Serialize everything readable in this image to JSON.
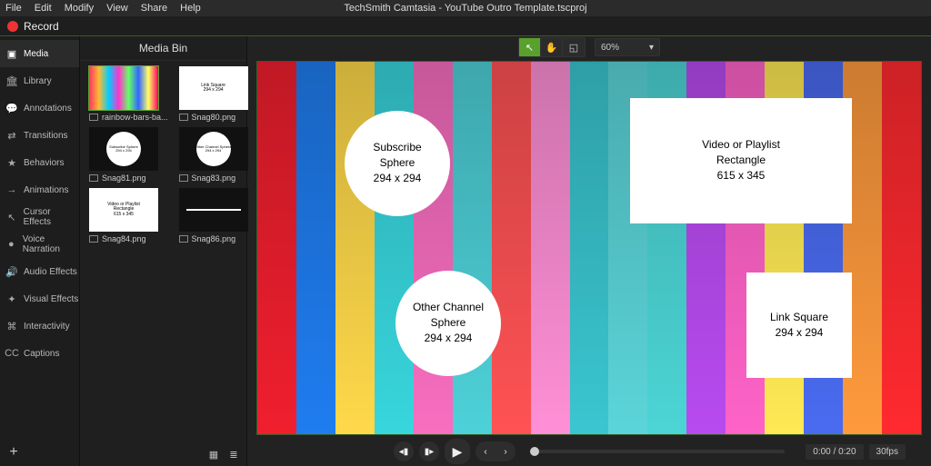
{
  "app_title": "TechSmith Camtasia - YouTube Outro Template.tscproj",
  "menu": [
    "File",
    "Edit",
    "Modify",
    "View",
    "Share",
    "Help"
  ],
  "record_label": "Record",
  "sidebar": [
    {
      "label": "Media",
      "icon": "▣"
    },
    {
      "label": "Library",
      "icon": "🏛"
    },
    {
      "label": "Annotations",
      "icon": "💬"
    },
    {
      "label": "Transitions",
      "icon": "⇄"
    },
    {
      "label": "Behaviors",
      "icon": "★"
    },
    {
      "label": "Animations",
      "icon": "→"
    },
    {
      "label": "Cursor Effects",
      "icon": "↖"
    },
    {
      "label": "Voice Narration",
      "icon": "●"
    },
    {
      "label": "Audio Effects",
      "icon": "🔊"
    },
    {
      "label": "Visual Effects",
      "icon": "✦"
    },
    {
      "label": "Interactivity",
      "icon": "⌘"
    },
    {
      "label": "Captions",
      "icon": "CC"
    }
  ],
  "bin": {
    "title": "Media Bin",
    "items": [
      {
        "name": "rainbow-bars-ba...",
        "kind": "rainbow",
        "text": ""
      },
      {
        "name": "Snag80.png",
        "kind": "square",
        "text": "Link Square\n294 x 294"
      },
      {
        "name": "Snag81.png",
        "kind": "circle",
        "text": "Subscribe Sphere\n294 x 294"
      },
      {
        "name": "Snag83.png",
        "kind": "circle",
        "text": "Other Channel Sphere\n294 x 294"
      },
      {
        "name": "Snag84.png",
        "kind": "rect",
        "text": "Video or Playlist\nRectangle\n615 x 345"
      },
      {
        "name": "Snag86.png",
        "kind": "blank",
        "text": ""
      }
    ]
  },
  "toolbar": {
    "zoom": "60%"
  },
  "canvas": {
    "bars_colors": [
      "#f01f2e",
      "#1f7df0",
      "#ffd94a",
      "#38d6dd",
      "#f86ec0",
      "#4dd1d8",
      "#ff5254",
      "#ff8fd6",
      "#3ac6d0",
      "#5bd5d9",
      "#4cd5d5",
      "#b84bf0",
      "#ff63c8",
      "#ffea54",
      "#4a6bf0",
      "#ff9a3d",
      "#ff2a2f"
    ],
    "placeholders": {
      "subscribe": "Subscribe\nSphere\n294 x 294",
      "other_channel": "Other Channel\nSphere\n294 x 294",
      "video_playlist": "Video or Playlist\nRectangle\n615 x 345",
      "link_square": "Link Square\n294 x 294"
    }
  },
  "transport": {
    "time": "0:00 / 0:20",
    "fps": "30fps"
  }
}
